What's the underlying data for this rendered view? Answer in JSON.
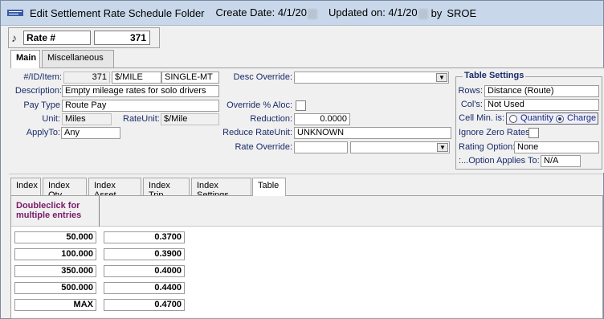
{
  "window": {
    "title": "Edit Settlement Rate Schedule Folder",
    "create_label": "Create Date: 4/1/20",
    "updated_label": "Updated on: 4/1/20",
    "by_label": "by",
    "user": "SROE"
  },
  "header": {
    "rate_label": "Rate #",
    "rate_number": "371"
  },
  "tabs_top": [
    "Main",
    "Miscellaneous"
  ],
  "main": {
    "id_item_label": "#/ID/Item:",
    "id_value": "371",
    "id_unit": "$/MILE",
    "id_item": "SINGLE-MT",
    "description_label": "Description:",
    "description_value": "Empty mileage rates for solo drivers",
    "pay_type_label": "Pay Type",
    "pay_type_value": "Route Pay",
    "unit_label": "Unit:",
    "unit_value": "Miles",
    "rate_unit_label": "RateUnit:",
    "rate_unit_value": "$/Mile",
    "apply_to_label": "ApplyTo:",
    "apply_to_value": "Any",
    "desc_override_label": "Desc Override:",
    "desc_override_value": "",
    "override_aloc_label": "Override % Aloc:",
    "reduction_label": "Reduction:",
    "reduction_value": "0.0000",
    "reduce_rate_unit_label": "Reduce RateUnit:",
    "reduce_rate_unit_value": "UNKNOWN",
    "rate_override_label": "Rate Override:",
    "rate_override_value": ""
  },
  "table_settings": {
    "title": "Table Settings",
    "rows_label": "Rows:",
    "rows_value": "Distance (Route)",
    "cols_label": "Col's:",
    "cols_value": "Not Used",
    "cell_min_label": "Cell Min. is:",
    "quantity_label": "Quantity",
    "charge_label": "Charge",
    "selected": "Charge",
    "ignore_zero_label": "Ignore Zero Rates",
    "rating_option_label": "Rating Option:",
    "rating_option_value": "None",
    "option_applies_label": ":...Option Applies To:",
    "option_applies_value": "N/A"
  },
  "tabs_bottom": [
    "Index",
    "Index Qty",
    "Index Asset",
    "Index Trip",
    "Index Settings",
    "Table"
  ],
  "active_bottom_tab": "Table",
  "grid": {
    "hint": "Doubleclick for multiple entries",
    "rows": [
      {
        "limit": "50.000",
        "rate": "0.3700"
      },
      {
        "limit": "100.000",
        "rate": "0.3900"
      },
      {
        "limit": "350.000",
        "rate": "0.4000"
      },
      {
        "limit": "500.000",
        "rate": "0.4400"
      },
      {
        "limit": "MAX",
        "rate": "0.4700"
      }
    ]
  }
}
